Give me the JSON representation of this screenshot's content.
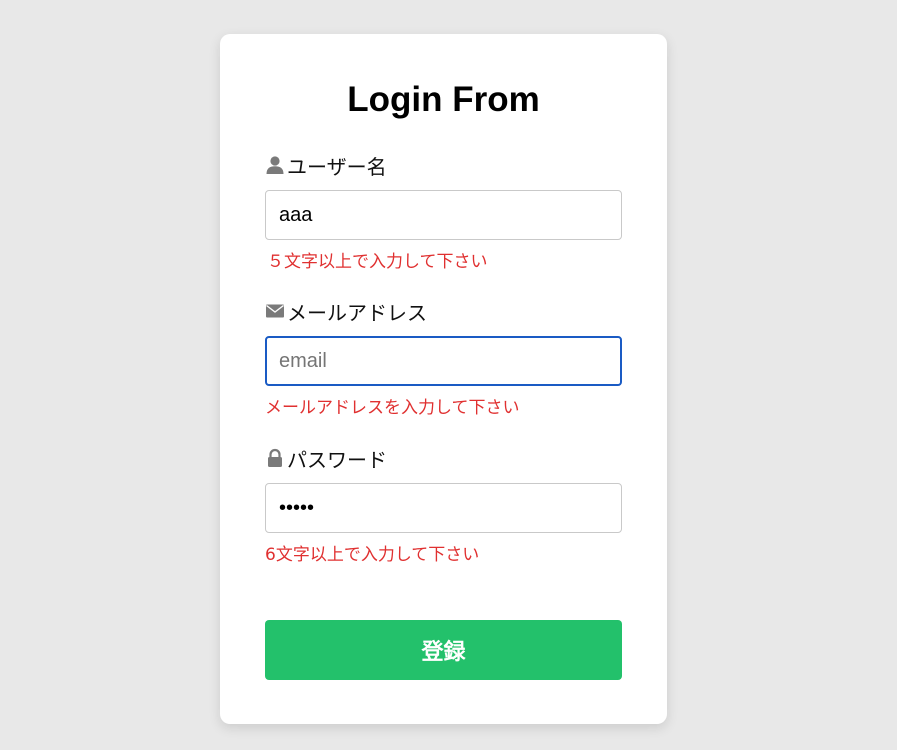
{
  "form": {
    "title": "Login From",
    "username": {
      "label": "ユーザー名",
      "icon": "user-icon",
      "value": "aaa",
      "placeholder": "",
      "error": "５文字以上で入力して下さい"
    },
    "email": {
      "label": "メールアドレス",
      "icon": "mail-icon",
      "value": "",
      "placeholder": "email",
      "error": "メールアドレスを入力して下さい"
    },
    "password": {
      "label": "パスワード",
      "icon": "lock-icon",
      "value": "aaaaa",
      "placeholder": "",
      "error": "6文字以上で入力して下さい"
    },
    "submit_label": "登録"
  },
  "colors": {
    "background": "#e8e8e8",
    "card": "#ffffff",
    "error": "#e03030",
    "focus_border": "#1a5bc4",
    "button": "#23c16b",
    "icon": "#7a7a7a"
  }
}
